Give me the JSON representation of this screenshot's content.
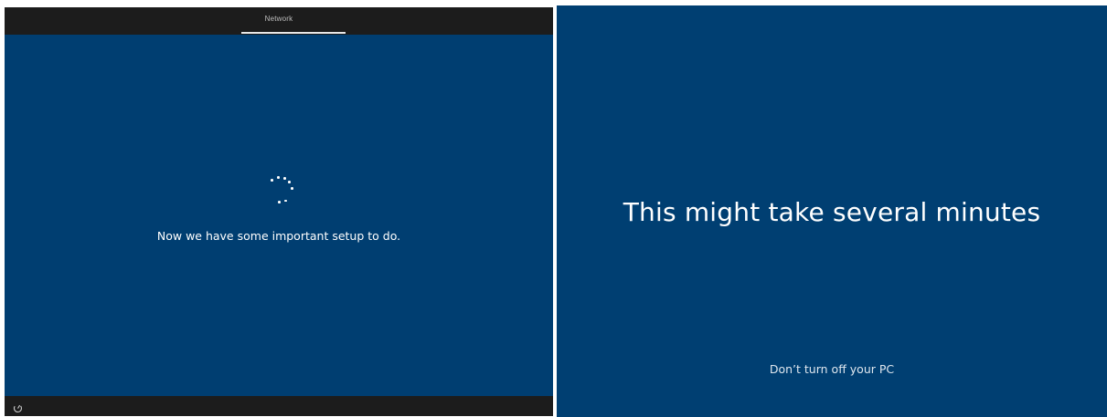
{
  "left_screen": {
    "header": {
      "tab_label": "Network"
    },
    "status_message": "Now we have some important setup to do.",
    "footer": {
      "accessibility_icon": "ease-of-access-icon"
    },
    "colors": {
      "background": "#003e71",
      "bars": "#1c1c1c"
    }
  },
  "right_screen": {
    "title": "This might take several minutes",
    "subtitle": "Don’t turn off your PC",
    "colors": {
      "background": "#003f72"
    }
  }
}
